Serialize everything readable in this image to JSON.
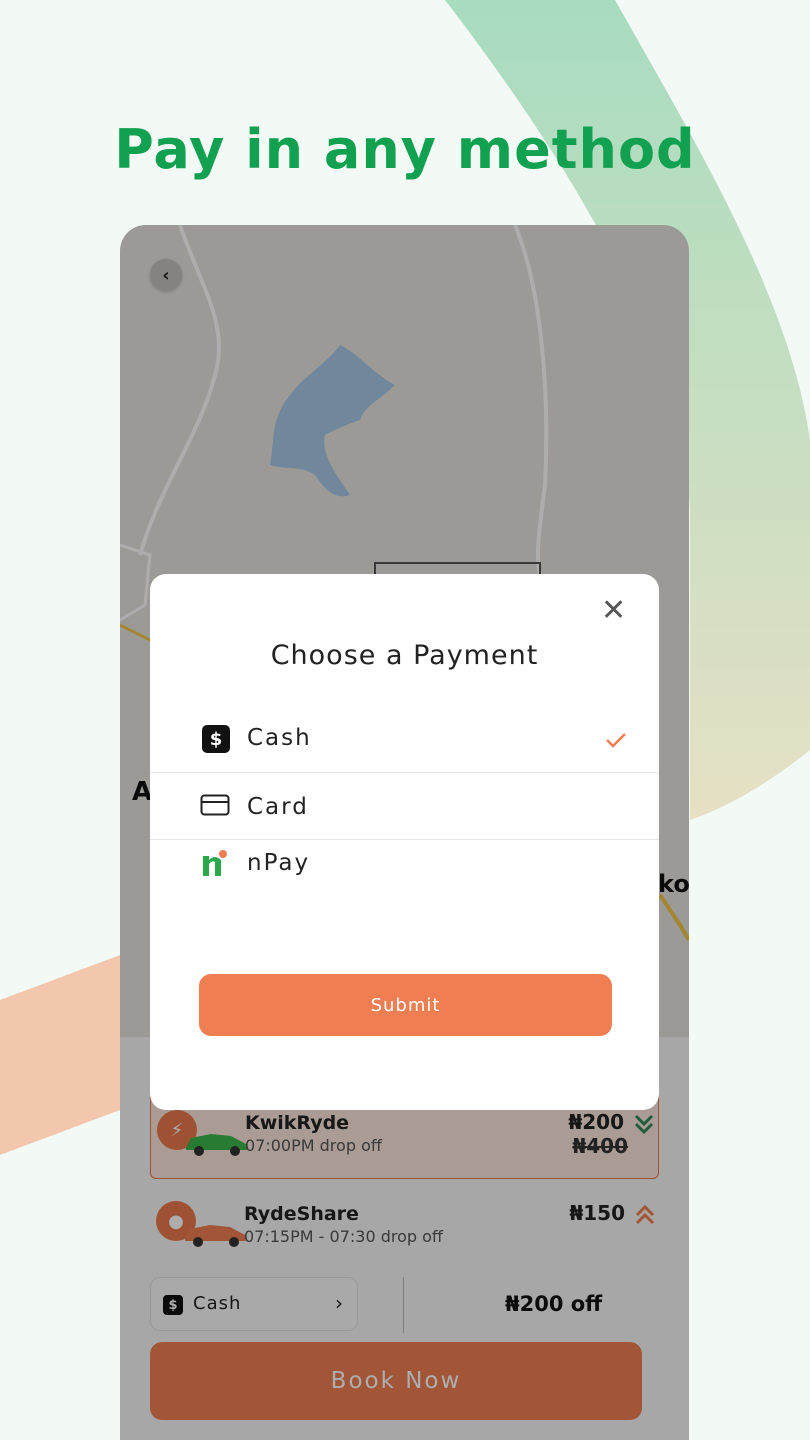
{
  "headline": "Pay in any method",
  "map": {
    "label_left": "A",
    "label_right": "ko"
  },
  "rides": [
    {
      "name": "KwikRyde",
      "time": "07:00PM drop off",
      "price": "₦200",
      "old_price": "₦400"
    },
    {
      "name": "RydeShare",
      "time": "07:15PM - 07:30 drop off",
      "price": "₦150"
    }
  ],
  "payment_pill": {
    "icon_glyph": "$",
    "label": "Cash",
    "arrow": "›"
  },
  "discount": "₦200 off",
  "book_button": "Book Now",
  "modal": {
    "title": "Choose a Payment",
    "close_glyph": "✕",
    "options": [
      {
        "label": "Cash",
        "icon": "cash-icon",
        "selected": true
      },
      {
        "label": "Card",
        "icon": "card-icon",
        "selected": false
      },
      {
        "label": "nPay",
        "icon": "npay-icon",
        "selected": false
      }
    ],
    "submit_label": "Submit"
  },
  "colors": {
    "accent": "#ef7f52",
    "headline": "#12a150",
    "background": "#f3faf6"
  }
}
